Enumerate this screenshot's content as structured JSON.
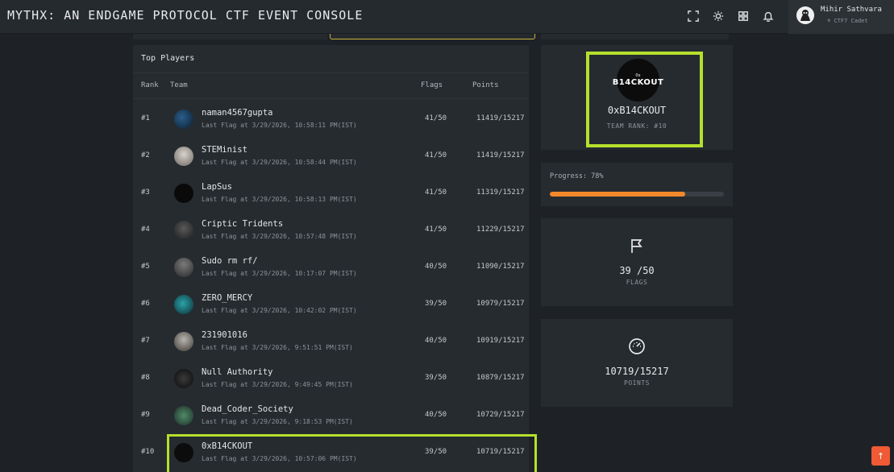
{
  "app": {
    "title": "MYTHX: AN ENDGAME PROTOCOL CTF EVENT CONSOLE"
  },
  "toolbar": {
    "icons": [
      "fullscreen-icon",
      "theme-toggle-icon",
      "apps-grid-icon",
      "notification-bell-icon"
    ]
  },
  "user": {
    "name": "Mihir Sathvara",
    "role": "CTF7 Cadet"
  },
  "leaderboard": {
    "title": "Top Players",
    "columns": {
      "rank": "Rank",
      "team": "Team",
      "flags": "Flags",
      "points": "Points"
    },
    "rows": [
      {
        "rank": "#1",
        "name": "naman4567gupta",
        "last": "Last Flag at 3/29/2026, 10:58:11 PM(IST)",
        "flags": "41/50",
        "points": "11419/15217"
      },
      {
        "rank": "#2",
        "name": "STEMinist",
        "last": "Last Flag at 3/29/2026, 10:58:44 PM(IST)",
        "flags": "41/50",
        "points": "11419/15217"
      },
      {
        "rank": "#3",
        "name": "LapSus",
        "last": "Last Flag at 3/29/2026, 10:58:13 PM(IST)",
        "flags": "41/50",
        "points": "11319/15217"
      },
      {
        "rank": "#4",
        "name": "Criptic Tridents",
        "last": "Last Flag at 3/29/2026, 10:57:48 PM(IST)",
        "flags": "41/50",
        "points": "11229/15217"
      },
      {
        "rank": "#5",
        "name": "Sudo rm rf/",
        "last": "Last Flag at 3/29/2026, 10:17:07 PM(IST)",
        "flags": "40/50",
        "points": "11090/15217"
      },
      {
        "rank": "#6",
        "name": "ZERO_MERCY",
        "last": "Last Flag at 3/29/2026, 10:42:02 PM(IST)",
        "flags": "39/50",
        "points": "10979/15217"
      },
      {
        "rank": "#7",
        "name": "231901016",
        "last": "Last Flag at 3/29/2026, 9:51:51 PM(IST)",
        "flags": "40/50",
        "points": "10919/15217"
      },
      {
        "rank": "#8",
        "name": "Null Authority",
        "last": "Last Flag at 3/29/2026, 9:49:45 PM(IST)",
        "flags": "39/50",
        "points": "10879/15217"
      },
      {
        "rank": "#9",
        "name": "Dead_Coder_Society",
        "last": "Last Flag at 3/29/2026, 9:18:53 PM(IST)",
        "flags": "40/50",
        "points": "10729/15217"
      },
      {
        "rank": "#10",
        "name": "0xB14CKOUT",
        "last": "Last Flag at 3/29/2026, 10:57:06 PM(IST)",
        "flags": "39/50",
        "points": "10719/15217"
      }
    ],
    "highlight_color": "#b6e02c"
  },
  "team_card": {
    "logo_small": "0x",
    "logo_text": "B14CKOUT",
    "name": "0xB14CKOUT",
    "rank_text": "TEAM RANK: #10"
  },
  "progress": {
    "label": "Progress: 78%",
    "percent": 78,
    "color": "#f3882b"
  },
  "flags_card": {
    "icon": "flag-icon",
    "value": "39 /50",
    "label": "FLAGS"
  },
  "points_card": {
    "icon": "speedometer-icon",
    "value": "10719/15217",
    "label": "POINTS"
  },
  "scroll_top": {
    "icon": "arrow-up-icon",
    "glyph": "↑"
  }
}
